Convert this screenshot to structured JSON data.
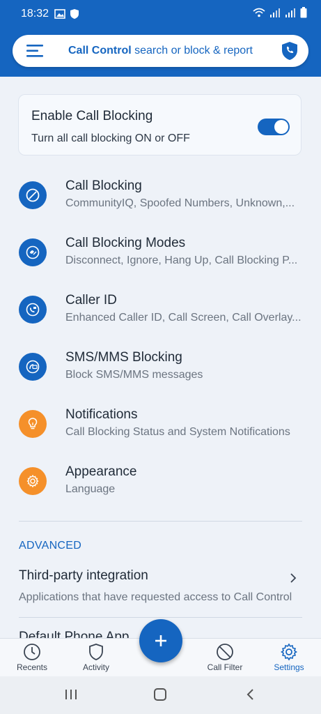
{
  "status_bar": {
    "time": "18:32"
  },
  "header": {
    "brand": "Call Control",
    "search_rest": " search or block & report"
  },
  "toggle_card": {
    "title": "Enable Call Blocking",
    "subtitle": "Turn all call blocking ON or OFF",
    "enabled": true
  },
  "settings_items": [
    {
      "title": "Call Blocking",
      "subtitle": "CommunityIQ, Spoofed Numbers, Unknown,...",
      "icon": "block-icon",
      "color": "#1565c0"
    },
    {
      "title": "Call Blocking Modes",
      "subtitle": "Disconnect, Ignore, Hang Up, Call Blocking P...",
      "icon": "modes-icon",
      "color": "#1565c0"
    },
    {
      "title": "Caller ID",
      "subtitle": "Enhanced Caller ID, Call Screen, Call Overlay...",
      "icon": "caller-id-icon",
      "color": "#1565c0"
    },
    {
      "title": "SMS/MMS Blocking",
      "subtitle": "Block SMS/MMS messages",
      "icon": "sms-block-icon",
      "color": "#1565c0"
    },
    {
      "title": "Notifications",
      "subtitle": "Call Blocking Status and System Notifications",
      "icon": "lightbulb-icon",
      "color": "#f5902a"
    },
    {
      "title": "Appearance",
      "subtitle": "Language",
      "icon": "gear-icon",
      "color": "#f5902a"
    }
  ],
  "advanced": {
    "header": "ADVANCED",
    "third_party_title": "Third-party integration",
    "third_party_subtitle": "Applications that have requested access to Call Control",
    "default_phone_title": "Default Phone App"
  },
  "bottom_nav": {
    "recents": "Recents",
    "activity": "Activity",
    "call_filter": "Call Filter",
    "settings": "Settings"
  },
  "colors": {
    "primary": "#1565c0",
    "accent_orange": "#f5902a"
  }
}
